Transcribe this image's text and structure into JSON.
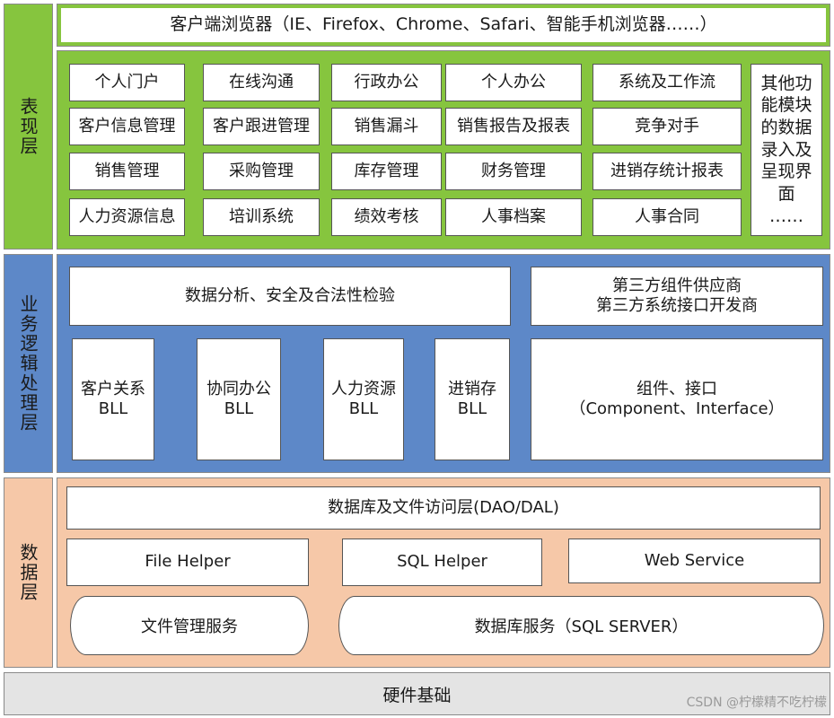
{
  "presentation": {
    "side_label": "表现层",
    "browser_bar": "客户端浏览器（IE、Firefox、Chrome、Safari、智能手机浏览器……）",
    "modules": [
      [
        "个人门户",
        "在线沟通",
        "行政办公",
        "个人办公",
        "系统及工作流"
      ],
      [
        "客户信息管理",
        "客户跟进管理",
        "销售漏斗",
        "销售报告及报表",
        "竞争对手"
      ],
      [
        "销售管理",
        "采购管理",
        "库存管理",
        "财务管理",
        "进销存统计报表"
      ],
      [
        "人力资源信息",
        "培训系统",
        "绩效考核",
        "人事档案",
        "人事合同"
      ]
    ],
    "other_modules": "其他功能模块的数据录入及呈现界面\n……"
  },
  "business": {
    "side_label": "业务逻辑处理层",
    "analysis": "数据分析、安全及合法性检验",
    "third_party": "第三方组件供应商\n第三方系统接口开发商",
    "bll": [
      "客户关系\nBLL",
      "协同办公\nBLL",
      "人力资源\nBLL",
      "进销存\nBLL"
    ],
    "component": "组件、接口\n（Component、Interface）"
  },
  "data": {
    "side_label": "数据层",
    "dal": "数据库及文件访问层(DAO/DAL)",
    "helpers": [
      "File Helper",
      "SQL Helper",
      "Web Service"
    ],
    "file_service": "文件管理服务",
    "db_service": "数据库服务（SQL SERVER）"
  },
  "hardware": {
    "label": "硬件基础"
  },
  "watermark": "CSDN @柠檬精不吃柠檬"
}
